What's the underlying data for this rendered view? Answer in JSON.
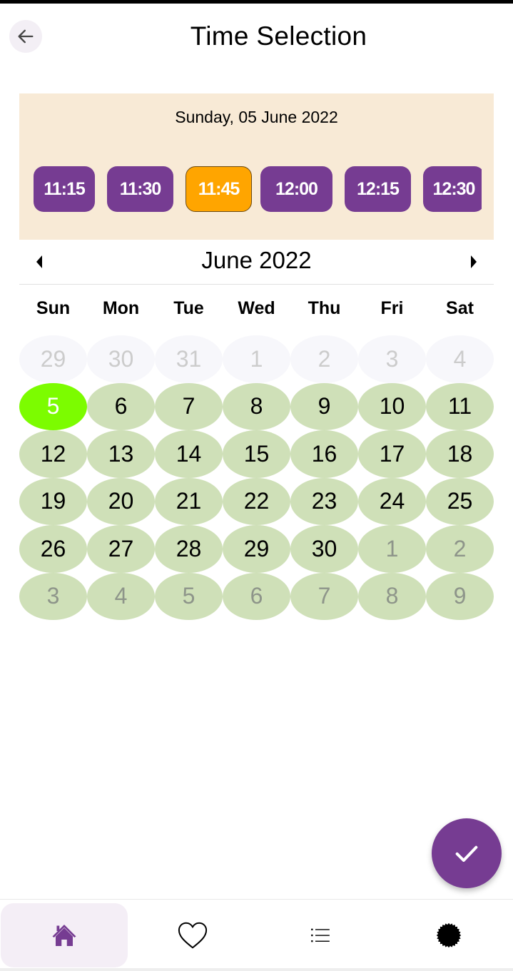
{
  "header": {
    "title": "Time Selection",
    "back_icon": "arrow-left-icon"
  },
  "time_panel": {
    "selected_date": "Sunday, 05 June 2022",
    "slots": [
      {
        "label": "11:15",
        "selected": false
      },
      {
        "label": "11:30",
        "selected": false
      },
      {
        "label": "11:45",
        "selected": true
      },
      {
        "label": "12:00",
        "selected": false
      },
      {
        "label": "12:15",
        "selected": false
      },
      {
        "label": "12:30",
        "selected": false
      }
    ]
  },
  "calendar": {
    "month_label": "June 2022",
    "prev_icon": "triangle-left-icon",
    "next_icon": "triangle-right-icon",
    "weekdays": [
      "Sun",
      "Mon",
      "Tue",
      "Wed",
      "Thu",
      "Fri",
      "Sat"
    ],
    "selected_day": 5,
    "days": [
      {
        "label": "29",
        "type": "prev"
      },
      {
        "label": "30",
        "type": "prev"
      },
      {
        "label": "31",
        "type": "prev"
      },
      {
        "label": "1",
        "type": "prev"
      },
      {
        "label": "2",
        "type": "prev"
      },
      {
        "label": "3",
        "type": "prev"
      },
      {
        "label": "4",
        "type": "prev"
      },
      {
        "label": "5",
        "type": "today"
      },
      {
        "label": "6",
        "type": "current"
      },
      {
        "label": "7",
        "type": "current"
      },
      {
        "label": "8",
        "type": "current"
      },
      {
        "label": "9",
        "type": "current"
      },
      {
        "label": "10",
        "type": "current"
      },
      {
        "label": "11",
        "type": "current"
      },
      {
        "label": "12",
        "type": "current"
      },
      {
        "label": "13",
        "type": "current"
      },
      {
        "label": "14",
        "type": "current"
      },
      {
        "label": "15",
        "type": "current"
      },
      {
        "label": "16",
        "type": "current"
      },
      {
        "label": "17",
        "type": "current"
      },
      {
        "label": "18",
        "type": "current"
      },
      {
        "label": "19",
        "type": "current"
      },
      {
        "label": "20",
        "type": "current"
      },
      {
        "label": "21",
        "type": "current"
      },
      {
        "label": "22",
        "type": "current"
      },
      {
        "label": "23",
        "type": "current"
      },
      {
        "label": "24",
        "type": "current"
      },
      {
        "label": "25",
        "type": "current"
      },
      {
        "label": "26",
        "type": "current"
      },
      {
        "label": "27",
        "type": "current"
      },
      {
        "label": "28",
        "type": "current"
      },
      {
        "label": "29",
        "type": "current"
      },
      {
        "label": "30",
        "type": "current"
      },
      {
        "label": "1",
        "type": "next"
      },
      {
        "label": "2",
        "type": "next"
      },
      {
        "label": "3",
        "type": "next"
      },
      {
        "label": "4",
        "type": "next"
      },
      {
        "label": "5",
        "type": "next"
      },
      {
        "label": "6",
        "type": "next"
      },
      {
        "label": "7",
        "type": "next"
      },
      {
        "label": "8",
        "type": "next"
      },
      {
        "label": "9",
        "type": "next"
      }
    ]
  },
  "fab": {
    "icon": "check-icon"
  },
  "bottom_nav": {
    "items": [
      {
        "name": "home",
        "icon": "home-icon",
        "active": true
      },
      {
        "name": "favorites",
        "icon": "heart-icon",
        "active": false
      },
      {
        "name": "list",
        "icon": "list-icon",
        "active": false
      },
      {
        "name": "badge",
        "icon": "badge-icon",
        "active": false
      }
    ]
  },
  "colors": {
    "primary": "#763c92",
    "slot_selected": "#ffa500",
    "panel_bg": "#f8ead6",
    "day_bg": "#cfe0b8",
    "today_bg": "#7cfc00"
  }
}
